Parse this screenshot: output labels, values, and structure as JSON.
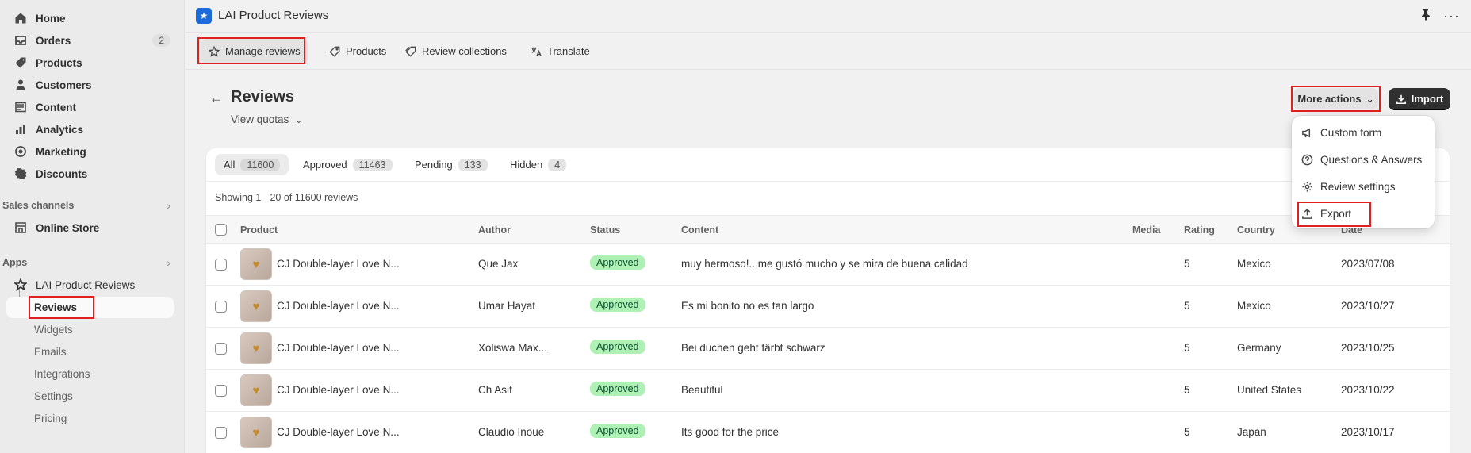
{
  "sidebar": {
    "nav": [
      {
        "label": "Home",
        "icon": "home-icon"
      },
      {
        "label": "Orders",
        "icon": "orders-icon",
        "badge": "2"
      },
      {
        "label": "Products",
        "icon": "tag-icon"
      },
      {
        "label": "Customers",
        "icon": "person-icon"
      },
      {
        "label": "Content",
        "icon": "content-icon"
      },
      {
        "label": "Analytics",
        "icon": "analytics-icon"
      },
      {
        "label": "Marketing",
        "icon": "marketing-icon"
      },
      {
        "label": "Discounts",
        "icon": "discount-icon"
      }
    ],
    "sales_channels_label": "Sales channels",
    "online_store": "Online Store",
    "apps_label": "Apps",
    "app_name": "LAI Product Reviews",
    "app_subitems": [
      "Reviews",
      "Widgets",
      "Emails",
      "Integrations",
      "Settings",
      "Pricing"
    ]
  },
  "header": {
    "title": "LAI Product Reviews",
    "tabs": [
      "Manage reviews",
      "Products",
      "Review collections",
      "Translate"
    ]
  },
  "page": {
    "back": "←",
    "title": "Reviews",
    "view_quotas": "View quotas",
    "more_actions": "More actions",
    "import": "Import"
  },
  "filters": [
    {
      "label": "All",
      "count": "11600"
    },
    {
      "label": "Approved",
      "count": "11463"
    },
    {
      "label": "Pending",
      "count": "133"
    },
    {
      "label": "Hidden",
      "count": "4"
    }
  ],
  "showing": "Showing 1 - 20 of 11600 reviews",
  "columns": [
    "Product",
    "Author",
    "Status",
    "Content",
    "Media",
    "Rating",
    "Country",
    "Date"
  ],
  "rows": [
    {
      "product": "CJ Double-layer Love N...",
      "author": "Que Jax",
      "status": "Approved",
      "content": "muy hermoso!.. me gustó mucho y se mira de buena calidad",
      "rating": "5",
      "country": "Mexico",
      "date": "2023/07/08"
    },
    {
      "product": "CJ Double-layer Love N...",
      "author": "Umar Hayat",
      "status": "Approved",
      "content": "Es mi bonito no es tan largo",
      "rating": "5",
      "country": "Mexico",
      "date": "2023/10/27"
    },
    {
      "product": "CJ Double-layer Love N...",
      "author": "Xoliswa Max...",
      "status": "Approved",
      "content": "Bei duchen geht färbt schwarz",
      "rating": "5",
      "country": "Germany",
      "date": "2023/10/25"
    },
    {
      "product": "CJ Double-layer Love N...",
      "author": "Ch Asif",
      "status": "Approved",
      "content": "Beautiful",
      "rating": "5",
      "country": "United States",
      "date": "2023/10/22"
    },
    {
      "product": "CJ Double-layer Love N...",
      "author": "Claudio Inoue",
      "status": "Approved",
      "content": "Its good for the price",
      "rating": "5",
      "country": "Japan",
      "date": "2023/10/17"
    }
  ],
  "dropdown": [
    "Custom form",
    "Questions & Answers",
    "Review settings",
    "Export"
  ]
}
